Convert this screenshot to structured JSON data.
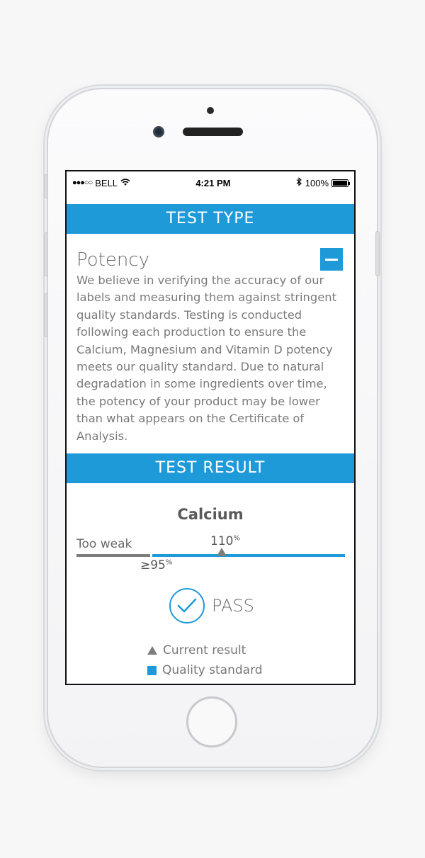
{
  "status_bar": {
    "signal": "●●●○○",
    "carrier": "BELL",
    "time": "4:21 PM",
    "battery_percent": "100%",
    "battery_level": 1.0
  },
  "test_type": {
    "header": "TEST TYPE",
    "title": "Potency",
    "description": "We believe in verifying the accuracy of our labels and measuring them against stringent quality standards. Testing is conducted following each production to ensure the Calcium, Magnesium and Vitamin D potency meets our quality standard. Due to natural degradation in some ingredients over time, the potency of your product may be lower than what appears on the Certificate of Analysis.",
    "collapse_icon": "minus-icon"
  },
  "test_result": {
    "header": "TEST RESULT",
    "analyte": "Calcium",
    "too_weak_label": "Too weak",
    "current_value": "110",
    "current_unit": "%",
    "threshold_value": "≥95",
    "threshold_unit": "%",
    "status": "PASS",
    "legend": {
      "current_result": "Current result",
      "quality_standard": "Quality standard"
    }
  },
  "colors": {
    "accent": "#1e9ad9",
    "gray": "#7d7d7d"
  }
}
